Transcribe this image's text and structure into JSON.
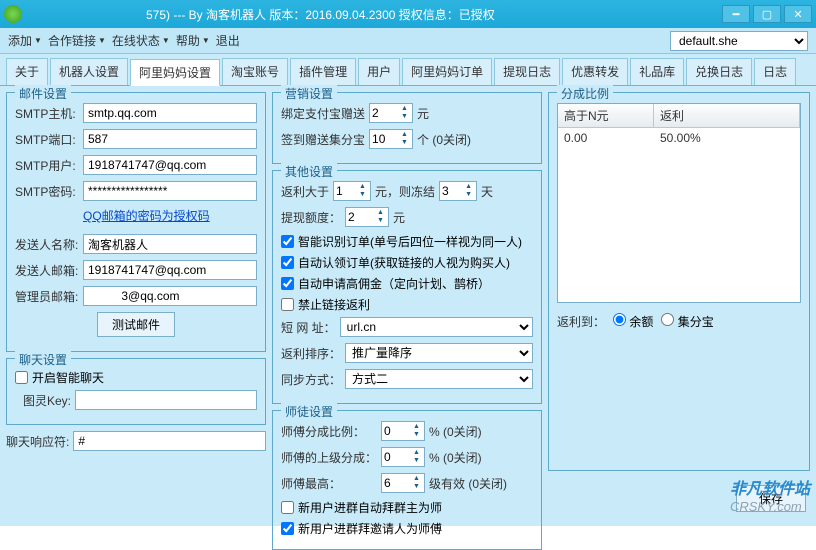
{
  "titlebar": {
    "text": "575) --- By 淘客机器人 版本：2016.09.04.2300 授权信息：已授权"
  },
  "menubar": {
    "add": "添加",
    "partner": "合作链接",
    "online": "在线状态",
    "help": "帮助",
    "exit": "退出",
    "profile": "default.she"
  },
  "tabs": [
    "关于",
    "机器人设置",
    "阿里妈妈设置",
    "淘宝账号",
    "插件管理",
    "用户",
    "阿里妈妈订单",
    "提现日志",
    "优惠转发",
    "礼品库",
    "兑换日志",
    "日志"
  ],
  "mail": {
    "legend": "邮件设置",
    "smtp_host_lbl": "SMTP主机:",
    "smtp_host": "smtp.qq.com",
    "smtp_port_lbl": "SMTP端口:",
    "smtp_port": "587",
    "smtp_user_lbl": "SMTP用户:",
    "smtp_user": "1918741747@qq.com",
    "smtp_pass_lbl": "SMTP密码:",
    "smtp_pass": "*****************",
    "pass_link": "QQ邮箱的密码为授权码",
    "sender_name_lbl": "发送人名称:",
    "sender_name": "淘客机器人",
    "sender_mail_lbl": "发送人邮箱:",
    "sender_mail": "1918741747@qq.com",
    "admin_mail_lbl": "管理员邮箱:",
    "admin_mail": "          3@qq.com",
    "test_btn": "测试邮件"
  },
  "chat": {
    "legend": "聊天设置",
    "smart": "开启智能聊天",
    "tuling_lbl": "图灵Key:",
    "tuling": "",
    "reply_lbl": "聊天响应符:",
    "reply": "#"
  },
  "marketing": {
    "legend": "营销设置",
    "bind_lbl": "绑定支付宝赠送",
    "bind_val": "2",
    "bind_unit": "元",
    "signin_lbl": "签到赠送集分宝",
    "signin_val": "10",
    "signin_unit": "个 (0关闭)"
  },
  "other": {
    "legend": "其他设置",
    "rebate_gt_lbl": "返利大于",
    "rebate_gt": "1",
    "rebate_unit": "元，则冻结",
    "freeze_days": "3",
    "days_unit": "天",
    "withdraw_lbl": "提现额度：",
    "withdraw": "2",
    "withdraw_unit": "元",
    "c1": "智能识别订单(单号后四位一样视为同一人)",
    "c2": "自动认领订单(获取链接的人视为购买人)",
    "c3": "自动申请高佣金（定向计划、鹊桥）",
    "c4": "禁止链接返利",
    "short_lbl": "短 网 址：",
    "short": "url.cn",
    "sort_lbl": "返利排序：",
    "sort": "推广量降序",
    "sync_lbl": "同步方式：",
    "sync": "方式二"
  },
  "apprentice": {
    "legend": "师徒设置",
    "r1_lbl": "师傅分成比例：",
    "r1_val": "0",
    "r1_unit": "% (0关闭)",
    "r2_lbl": "师傅的上级分成：",
    "r2_val": "0",
    "r2_unit": "% (0关闭)",
    "r3_lbl": "师傅最高：",
    "r3_val": "6",
    "r3_unit": "级有效 (0关闭)",
    "c5": "新用户进群自动拜群主为师",
    "c6": "新用户进群拜邀请人为师傅"
  },
  "ratio": {
    "legend": "分成比例",
    "h1": "高于N元",
    "h2": "返利",
    "d1": "0.00",
    "d2": "50.00%",
    "to_lbl": "返利到：",
    "opt1": "余额",
    "opt2": "集分宝"
  },
  "save_btn": "保存",
  "watermark": {
    "l1": "非凡软件站",
    "l2": "CRSKY.com"
  }
}
